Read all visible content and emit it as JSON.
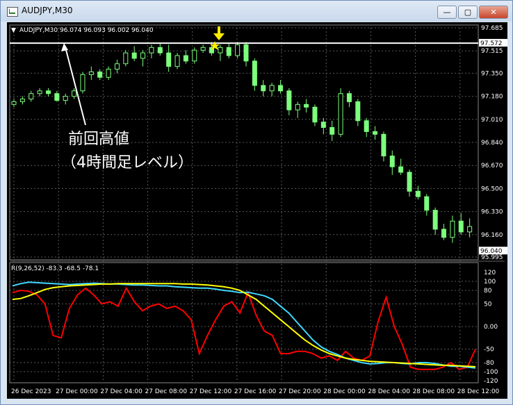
{
  "window": {
    "title": "AUDJPY,M30"
  },
  "buttons": {
    "minimize": "—",
    "restore": "▢",
    "close": "✕"
  },
  "main_header": "AUDJPY,M30  96.074 96.093 96.002 96.040",
  "sub_header": "R(9,26,52) -83.3 -68.5 -78.1",
  "annotation": {
    "line1": "前回高値",
    "line2": "（4時間足レベル）"
  },
  "colors": {
    "up_candle": "#7cff7c",
    "osc_red": "#ff0000",
    "osc_cyan": "#3fd8ff",
    "osc_yellow": "#ffff00",
    "marker": "#ffee00"
  },
  "icons": [
    "arrow-down-icon",
    "star-icon"
  ],
  "price_axis": {
    "ticks": [
      "97.685",
      "97.515",
      "97.350",
      "97.180",
      "97.010",
      "96.840",
      "96.670",
      "96.500",
      "96.330",
      "96.160",
      "95.995"
    ],
    "resistance_level": "97.572",
    "current_price": "96.040"
  },
  "osc_axis": {
    "ticks": [
      "120",
      "100",
      "80",
      "50",
      "0.00",
      "-50",
      "-80",
      "-100",
      "-120"
    ]
  },
  "time_axis": [
    "26 Dec 2023",
    "27 Dec 00:00",
    "27 Dec 04:00",
    "27 Dec 08:00",
    "27 Dec 12:00",
    "27 Dec 16:00",
    "27 Dec 20:00",
    "28 Dec 00:00",
    "28 Dec 04:00",
    "28 Dec 08:00",
    "28 Dec 12:00"
  ],
  "chart_data": [
    {
      "type": "candlestick",
      "title": "AUDJPY,M30",
      "ylim": [
        95.995,
        97.685
      ],
      "resistance": 97.572,
      "last_price": 96.04,
      "ohlc": [
        [
          97.12,
          97.16,
          97.1,
          97.14
        ],
        [
          97.14,
          97.18,
          97.12,
          97.16
        ],
        [
          97.16,
          97.22,
          97.14,
          97.2
        ],
        [
          97.2,
          97.24,
          97.18,
          97.22
        ],
        [
          97.22,
          97.24,
          97.18,
          97.2
        ],
        [
          97.2,
          97.22,
          97.14,
          97.15
        ],
        [
          97.15,
          97.2,
          97.12,
          97.18
        ],
        [
          97.18,
          97.24,
          97.16,
          97.22
        ],
        [
          97.22,
          97.36,
          97.2,
          97.34
        ],
        [
          97.34,
          97.4,
          97.3,
          97.36
        ],
        [
          97.36,
          97.38,
          97.3,
          97.32
        ],
        [
          97.32,
          97.4,
          97.3,
          97.38
        ],
        [
          97.38,
          97.45,
          97.35,
          97.42
        ],
        [
          97.42,
          97.52,
          97.4,
          97.5
        ],
        [
          97.5,
          97.55,
          97.44,
          97.46
        ],
        [
          97.46,
          97.52,
          97.4,
          97.5
        ],
        [
          97.5,
          97.56,
          97.46,
          97.54
        ],
        [
          97.54,
          97.57,
          97.48,
          97.5
        ],
        [
          97.5,
          97.56,
          97.36,
          97.4
        ],
        [
          97.4,
          97.5,
          97.38,
          97.48
        ],
        [
          97.48,
          97.52,
          97.42,
          97.44
        ],
        [
          97.44,
          97.54,
          97.42,
          97.52
        ],
        [
          97.52,
          97.56,
          97.5,
          97.54
        ],
        [
          97.54,
          97.58,
          97.48,
          97.5
        ],
        [
          97.5,
          97.56,
          97.44,
          97.54
        ],
        [
          97.54,
          97.57,
          97.46,
          97.48
        ],
        [
          97.48,
          97.58,
          97.46,
          97.56
        ],
        [
          97.56,
          97.58,
          97.4,
          97.44
        ],
        [
          97.44,
          97.46,
          97.22,
          97.26
        ],
        [
          97.26,
          97.3,
          97.18,
          97.22
        ],
        [
          97.22,
          97.28,
          97.18,
          97.26
        ],
        [
          97.26,
          97.3,
          97.2,
          97.22
        ],
        [
          97.22,
          97.24,
          97.04,
          97.08
        ],
        [
          97.08,
          97.14,
          97.02,
          97.12
        ],
        [
          97.12,
          97.16,
          97.06,
          97.1
        ],
        [
          97.1,
          97.12,
          96.96,
          96.99
        ],
        [
          96.99,
          97.02,
          96.9,
          96.95
        ],
        [
          96.95,
          97.0,
          96.85,
          96.9
        ],
        [
          96.9,
          97.24,
          96.88,
          97.2
        ],
        [
          97.2,
          97.22,
          97.1,
          97.14
        ],
        [
          97.14,
          97.16,
          96.96,
          97.0
        ],
        [
          97.0,
          97.02,
          96.88,
          96.92
        ],
        [
          96.92,
          96.96,
          96.86,
          96.9
        ],
        [
          96.9,
          96.92,
          96.7,
          96.74
        ],
        [
          96.74,
          96.78,
          96.6,
          96.66
        ],
        [
          96.66,
          96.72,
          96.6,
          96.62
        ],
        [
          96.62,
          96.64,
          96.44,
          96.48
        ],
        [
          96.48,
          96.52,
          96.42,
          96.44
        ],
        [
          96.44,
          96.46,
          96.3,
          96.34
        ],
        [
          96.34,
          96.36,
          96.16,
          96.2
        ],
        [
          96.2,
          96.24,
          96.12,
          96.14
        ],
        [
          96.14,
          96.3,
          96.1,
          96.26
        ],
        [
          96.26,
          96.32,
          96.16,
          96.18
        ],
        [
          96.18,
          96.28,
          96.14,
          96.22
        ]
      ]
    },
    {
      "type": "line",
      "title": "R(9,26,52)",
      "ylim": [
        -120,
        120
      ],
      "last_values": [
        -83.3,
        -68.5,
        -78.1
      ],
      "series": [
        {
          "name": "R9",
          "values": [
            75,
            80,
            78,
            70,
            50,
            -20,
            -25,
            40,
            70,
            85,
            70,
            50,
            55,
            45,
            85,
            55,
            35,
            45,
            50,
            40,
            45,
            35,
            15,
            -60,
            -20,
            15,
            45,
            55,
            30,
            75,
            25,
            -10,
            -20,
            -60,
            -60,
            -55,
            -55,
            -60,
            -70,
            -65,
            -75,
            -55,
            -70,
            -75,
            -65,
            10,
            65,
            0,
            -40,
            -90,
            -95,
            -95,
            -95,
            -90,
            -80,
            -95,
            -90,
            -50
          ]
        },
        {
          "name": "R26",
          "values": [
            90,
            95,
            98,
            97,
            96,
            95,
            94,
            93,
            94,
            95,
            96,
            95,
            94,
            94,
            93,
            92,
            92,
            91,
            90,
            90,
            88,
            87,
            86,
            85,
            85,
            83,
            80,
            78,
            75,
            76,
            72,
            68,
            60,
            45,
            30,
            10,
            -10,
            -30,
            -45,
            -55,
            -62,
            -70,
            -75,
            -80,
            -83,
            -82,
            -80,
            -80,
            -82,
            -83,
            -80,
            -80,
            -82,
            -85,
            -88,
            -88,
            -90,
            -92
          ]
        },
        {
          "name": "R52",
          "values": [
            60,
            62,
            68,
            75,
            82,
            86,
            88,
            90,
            91,
            92,
            93,
            94,
            94,
            95,
            95,
            95,
            95,
            95,
            95,
            95,
            95,
            94,
            94,
            93,
            92,
            90,
            88,
            85,
            80,
            70,
            60,
            45,
            30,
            15,
            0,
            -15,
            -30,
            -42,
            -52,
            -60,
            -65,
            -70,
            -73,
            -75,
            -77,
            -78,
            -79,
            -80,
            -81,
            -82,
            -83,
            -84,
            -85,
            -86,
            -86,
            -87,
            -88,
            -89
          ]
        }
      ]
    }
  ]
}
